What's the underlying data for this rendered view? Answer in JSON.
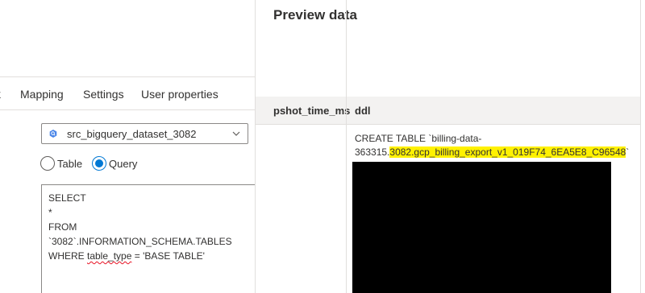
{
  "left_pane": {
    "tabs": [
      {
        "label": "k"
      },
      {
        "label": "Mapping"
      },
      {
        "label": "Settings"
      },
      {
        "label": "User properties"
      }
    ],
    "dataset": {
      "selected": "src_bigquery_dataset_3082",
      "icon": "bigquery-icon",
      "icon_color": "#4a86e8"
    },
    "source_type": {
      "options": [
        "Table",
        "Query"
      ],
      "selected": "Query"
    },
    "query": {
      "line1": "SELECT",
      "line2": "*",
      "line3": "FROM",
      "line4": "`3082`.INFORMATION_SCHEMA.TABLES",
      "line5_prefix": "WHERE ",
      "line5_squiggle": "table_type",
      "line5_suffix": " = 'BASE TABLE'"
    }
  },
  "preview": {
    "title": "Preview data",
    "columns": [
      "pshot_time_ms",
      "ddl"
    ],
    "ddl_cell": {
      "plain_start": "CREATE TABLE `billing-data-363315.",
      "highlighted": "3082.gcp_billing_export_v1_019F74_6EA5E8_C96548",
      "plain_end": "`"
    }
  },
  "colors": {
    "accent": "#0078d4",
    "highlight": "#fff100",
    "redaction": "#000000"
  }
}
